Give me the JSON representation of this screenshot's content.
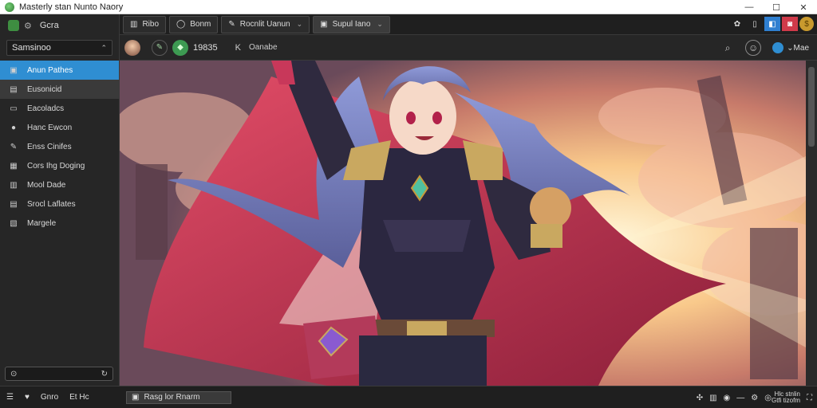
{
  "window": {
    "title": "Masterly stan Nunto Naory",
    "controls": {
      "minimize": "—",
      "maximize": "☐",
      "close": "✕"
    }
  },
  "sidebar": {
    "header_label": "Gcra",
    "select_label": "Samsinoo",
    "items": [
      {
        "label": "Anun Pathes",
        "icon": "image-icon",
        "glyph": "▣"
      },
      {
        "label": "Eusonicid",
        "icon": "document-icon",
        "glyph": "▤"
      },
      {
        "label": "Eacoladcs",
        "icon": "monitor-icon",
        "glyph": "▭"
      },
      {
        "label": "Hanc Ewcon",
        "icon": "coin-icon",
        "glyph": "●"
      },
      {
        "label": "Enss Cinifes",
        "icon": "brush-icon",
        "glyph": "✎"
      },
      {
        "label": "Cors Ihg Doging",
        "icon": "film-icon",
        "glyph": "▦"
      },
      {
        "label": "Mool Dade",
        "icon": "grid-icon",
        "glyph": "▥"
      },
      {
        "label": "Srocl Laflates",
        "icon": "layers-icon",
        "glyph": "▤"
      },
      {
        "label": "Margele",
        "icon": "folder-icon",
        "glyph": "▧"
      }
    ],
    "search_glyph": "⊙",
    "refresh_glyph": "↻"
  },
  "tabs": [
    {
      "label": "Ribo",
      "icon": "▥"
    },
    {
      "label": "Bonm",
      "icon": "◯"
    },
    {
      "label": "Rocnlit Uanun",
      "icon": "✎",
      "close": "⌄"
    },
    {
      "label": "Supul Iano",
      "icon": "▣",
      "close": "⌄"
    }
  ],
  "tab_right": {
    "settings": "✿",
    "layout": "▯",
    "blue": "◧",
    "red": "◙"
  },
  "toolbar": {
    "count": "19835",
    "k": "K",
    "label": "Oanabe",
    "dropdown_label": "Mae"
  },
  "statusbar": {
    "menu": "☰",
    "like": "♥",
    "left_label": "Gnro",
    "left_extra": "Et  Hc",
    "input_value": "Rasg lor Rnarm",
    "right_stat_1": "Hlc stnlin",
    "right_stat_2": "Gtfi tizofm"
  },
  "colors": {
    "accent": "#2f8ed2",
    "sidebar_bg": "#262626",
    "red_badge": "#d03a4a"
  }
}
